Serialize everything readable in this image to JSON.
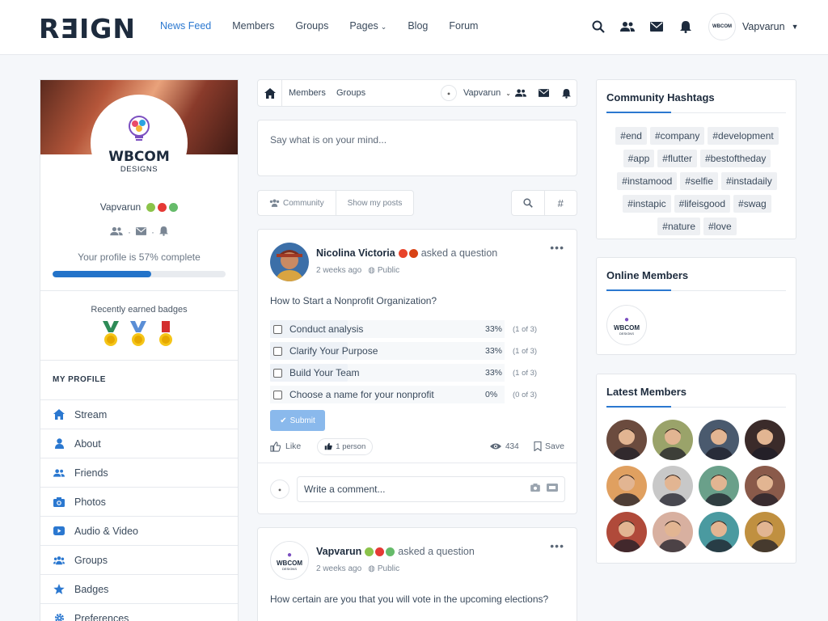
{
  "header": {
    "logo": "REIGN",
    "nav": [
      {
        "label": "News Feed",
        "active": true
      },
      {
        "label": "Members"
      },
      {
        "label": "Groups"
      },
      {
        "label": "Pages",
        "dropdown": true
      },
      {
        "label": "Blog"
      },
      {
        "label": "Forum"
      }
    ],
    "user": {
      "name": "Vapvarun",
      "avatar_text": "WBCOM"
    }
  },
  "profile": {
    "brand": "WBCOM",
    "brand_sub": "DESIGNS",
    "name": "Vapvarun",
    "completion_text": "Your profile is 57% complete",
    "completion_percent": 57,
    "badges_title": "Recently earned badges",
    "section_title": "MY PROFILE",
    "menu": [
      {
        "label": "Stream",
        "icon": "home-icon"
      },
      {
        "label": "About",
        "icon": "user-icon"
      },
      {
        "label": "Friends",
        "icon": "friends-icon"
      },
      {
        "label": "Photos",
        "icon": "camera-icon"
      },
      {
        "label": "Audio & Video",
        "icon": "video-icon"
      },
      {
        "label": "Groups",
        "icon": "groups-icon"
      },
      {
        "label": "Badges",
        "icon": "star-icon"
      },
      {
        "label": "Preferences",
        "icon": "gear-icon"
      }
    ]
  },
  "subnav": {
    "links": [
      "Members",
      "Groups"
    ],
    "user": "Vapvarun"
  },
  "composer": {
    "placeholder": "Say what is on your mind..."
  },
  "filters": {
    "tabs": [
      "Community",
      "Show my posts"
    ],
    "search_symbol": "⌕",
    "hash_symbol": "#"
  },
  "posts": [
    {
      "author": "Nicolina Victoria",
      "action": "asked a question",
      "time": "2 weeks ago",
      "visibility": "Public",
      "question": "How to Start a Nonprofit Organization?",
      "options": [
        {
          "label": "Conduct analysis",
          "percent": "33%",
          "votes": "(1 of 3)",
          "fill": 33
        },
        {
          "label": "Clarify Your Purpose",
          "percent": "33%",
          "votes": "(1 of 3)",
          "fill": 33
        },
        {
          "label": "Build Your Team",
          "percent": "33%",
          "votes": "(1 of 3)",
          "fill": 33
        },
        {
          "label": "Choose a name for your nonprofit",
          "percent": "0%",
          "votes": "(0 of 3)",
          "fill": 0
        }
      ],
      "submit_label": "Submit",
      "like_label": "Like",
      "likers": "1 person",
      "views": "434",
      "save_label": "Save",
      "comment_placeholder": "Write a comment..."
    },
    {
      "author": "Vapvarun",
      "action": "asked a question",
      "time": "2 weeks ago",
      "visibility": "Public",
      "question": "How certain are you that you will vote in the upcoming elections?",
      "avatar_text": "WBCOM",
      "avatar_sub": "DESIGNS"
    }
  ],
  "hashtags": {
    "title": "Community Hashtags",
    "tags": [
      "#end",
      "#company",
      "#development",
      "#app",
      "#flutter",
      "#bestoftheday",
      "#instamood",
      "#selfie",
      "#instadaily",
      "#instapic",
      "#lifeisgood",
      "#swag",
      "#nature",
      "#love"
    ]
  },
  "online": {
    "title": "Online Members",
    "avatar_text": "WBCOM",
    "avatar_sub": "DESIGNS"
  },
  "latest": {
    "title": "Latest Members",
    "colors": [
      "#6b4b3e",
      "#9aa36a",
      "#4a5a6e",
      "#3b2b2a",
      "#e0a060",
      "#c8c8c8",
      "#6aa08a",
      "#8a5a4a",
      "#b04a3a",
      "#d8b0a0",
      "#4a9aa0",
      "#c09040"
    ]
  },
  "colors": {
    "accent": "#2b78d0",
    "dark": "#1d2b3d"
  }
}
